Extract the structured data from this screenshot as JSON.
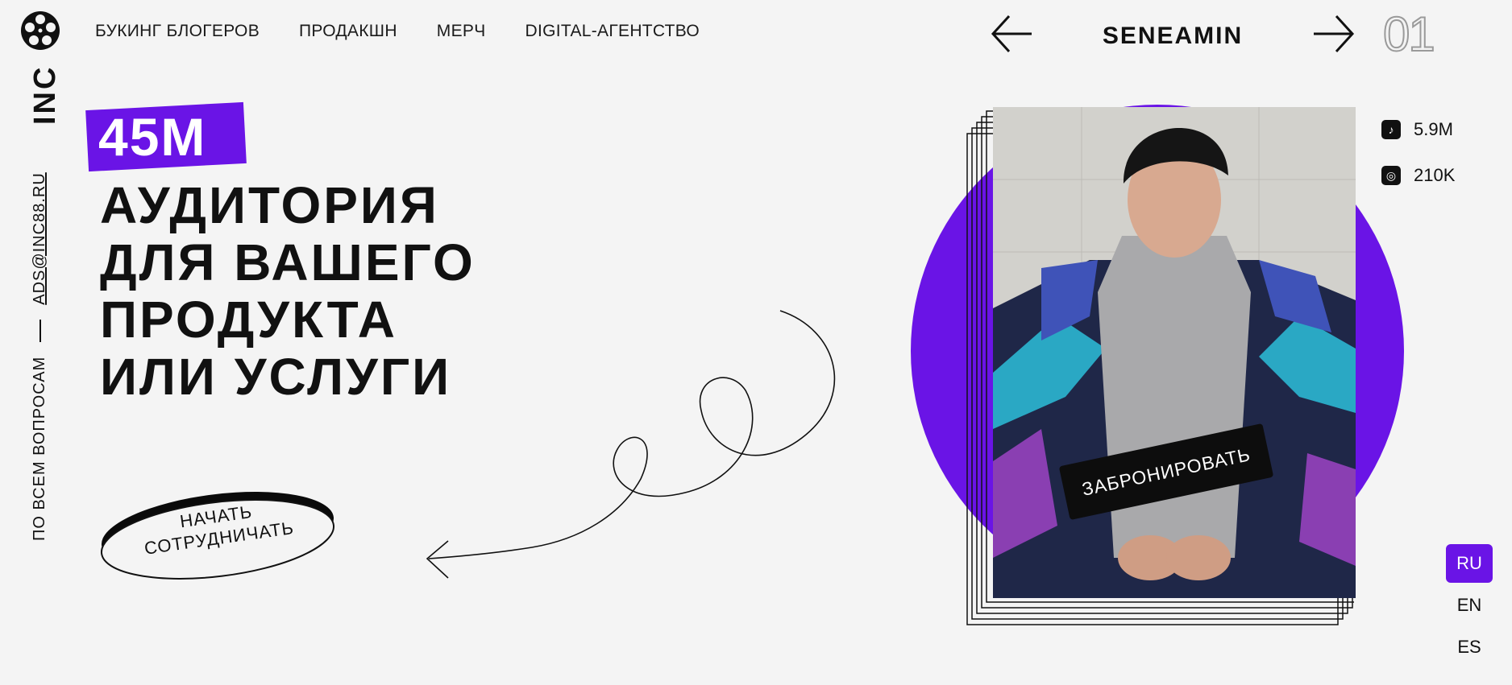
{
  "brand": {
    "logo_icon": "film-reel-icon",
    "name": "INC"
  },
  "contact": {
    "label": "ПО ВСЕМ ВОПРОСАМ",
    "email": "ADS@INC88.RU"
  },
  "nav": [
    "БУКИНГ БЛОГЕРОВ",
    "ПРОДАКШН",
    "МЕРЧ",
    "DIGITAL-АГЕНТСТВО"
  ],
  "slider": {
    "blogger": "SENEAMIN",
    "index": "01",
    "prev_icon": "arrow-left-icon",
    "next_icon": "arrow-right-icon"
  },
  "hero": {
    "badge": "45M",
    "headline": [
      "АУДИТОРИЯ",
      "ДЛЯ ВАШЕГО",
      "ПРОДУКТА",
      "ИЛИ УСЛУГИ"
    ],
    "cta": [
      "НАЧАТЬ",
      "СОТРУДНИЧАТЬ"
    ]
  },
  "card": {
    "book_label": "ЗАБРОНИРОВАТЬ"
  },
  "social": [
    {
      "icon": "tiktok-icon",
      "value": "5.9M"
    },
    {
      "icon": "instagram-icon",
      "value": "210K"
    }
  ],
  "languages": [
    "RU",
    "EN",
    "ES"
  ],
  "active_language": "RU",
  "colors": {
    "accent": "#6a14e6",
    "background": "#f4f4f4",
    "text": "#111111"
  }
}
